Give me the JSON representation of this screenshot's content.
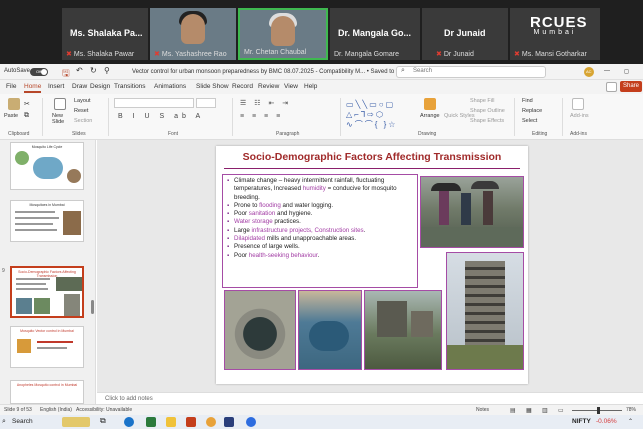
{
  "meeting": {
    "tiles": [
      {
        "name": "Ms. Shalaka Pa...",
        "label": "Ms. Shalaka Pawar",
        "muted": true
      },
      {
        "name": "",
        "label": "Ms. Yashashree Rao",
        "muted": true,
        "video": true
      },
      {
        "name": "",
        "label": "Mr. Chetan Chaubal",
        "muted": false,
        "video": true,
        "active": true
      },
      {
        "name": "Dr. Mangala Go...",
        "label": "Dr. Mangala Gomare",
        "muted": false
      },
      {
        "name": "Dr Junaid",
        "label": "Dr Junaid",
        "muted": true
      },
      {
        "name": "RCUES",
        "sub": "Mumbai",
        "label": "Ms. Mansi Gotharkar",
        "muted": true
      }
    ]
  },
  "titlebar": {
    "autosave": "AutoSave",
    "autosave_state": "Off",
    "doc_title": "Vector control for urban monsoon preparedness by BMC 08.07.2025  -  Compatibility M...  •  Saved to this PC ⌄",
    "search_placeholder": "Search",
    "avatar": "AC",
    "min": "—",
    "restore": "◻"
  },
  "tabs": [
    "File",
    "Home",
    "Insert",
    "Draw",
    "Design",
    "Transitions",
    "Animations",
    "Slide Show",
    "Record",
    "Review",
    "View",
    "Help"
  ],
  "share": "Share",
  "ribbon": {
    "paste": "Paste",
    "new_slide": "New Slide",
    "layout": "Layout",
    "reset": "Reset",
    "section": "Section",
    "arrange": "Arrange",
    "quick_styles": "Quick Styles",
    "shape_fill": "Shape Fill",
    "shape_outline": "Shape Outline",
    "shape_effects": "Shape Effects",
    "find": "Find",
    "replace": "Replace",
    "select": "Select",
    "addins": "Add-ins",
    "groups": [
      "Clipboard",
      "Slides",
      "Font",
      "Paragraph",
      "Drawing",
      "Editing",
      "Add-ins"
    ]
  },
  "thumbnails": [
    {
      "num": "",
      "title": "Mosquito Life Cycle"
    },
    {
      "num": "",
      "title": "Mosquito Life Cycle"
    },
    {
      "num": "",
      "title": "Mosquitoes in Mumbai"
    },
    {
      "num": "9",
      "title": "Socio-Demographic Factors Affecting Transmission"
    },
    {
      "num": "",
      "title": "Mosquito Vector control in Mumbai"
    },
    {
      "num": "",
      "title": "Anopheles Mosquito control in Mumbai"
    }
  ],
  "slide": {
    "title": "Socio-Demographic Factors Affecting Transmission",
    "bullets": [
      {
        "pre": "Climate change – heavy intermittent rainfall, fluctuating temperatures, Increased ",
        "hl": "humidity",
        "post": " = conducive for mosquito breeding."
      },
      {
        "pre": "Prone to ",
        "hl": "flooding",
        "post": " and water logging."
      },
      {
        "pre": "Poor ",
        "hl": "sanitation",
        "post": " and hygiene."
      },
      {
        "pre": "",
        "hl": "Water storage",
        "post": " practices."
      },
      {
        "pre": "Large ",
        "hl": "infrastructure projects, Construction sites",
        "post": "."
      },
      {
        "pre": "",
        "hl": "Dilapidated",
        "post": " mills and unapproachable areas."
      },
      {
        "pre": "Presence of large wells.",
        "hl": "",
        "post": ""
      },
      {
        "pre": "Poor ",
        "hl": "health-seeking behaviour",
        "post": "."
      }
    ]
  },
  "notes_placeholder": "Click to add notes",
  "status": {
    "slide_of": "Slide 9 of 53",
    "language": "English (India)",
    "accessibility": "Accessibility: Unavailable",
    "notes_btn": "Notes",
    "zoom": "78%"
  },
  "taskbar": {
    "search": "Search",
    "ticker": "NIFTY",
    "change": "-0.06%"
  }
}
